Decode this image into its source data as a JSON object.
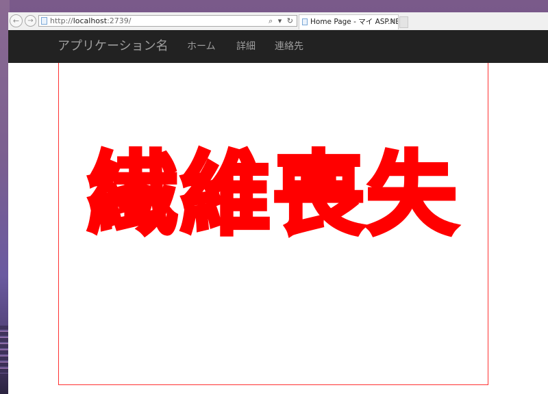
{
  "browser": {
    "url_prefix": "http://",
    "url_host": "localhost",
    "url_rest": ":2739/",
    "address_tools": "⌕ ▾ ↻",
    "tab_title": "Home Page - マイ ASP.NET...",
    "tab_close": "×",
    "back_glyph": "←",
    "forward_glyph": "→"
  },
  "navbar": {
    "brand": "アプリケーション名",
    "links": [
      "ホーム",
      "詳細",
      "連絡先"
    ]
  },
  "main": {
    "big_text": "繊維喪失",
    "text_color": "#ff0000",
    "frame_color": "#ff3030"
  }
}
